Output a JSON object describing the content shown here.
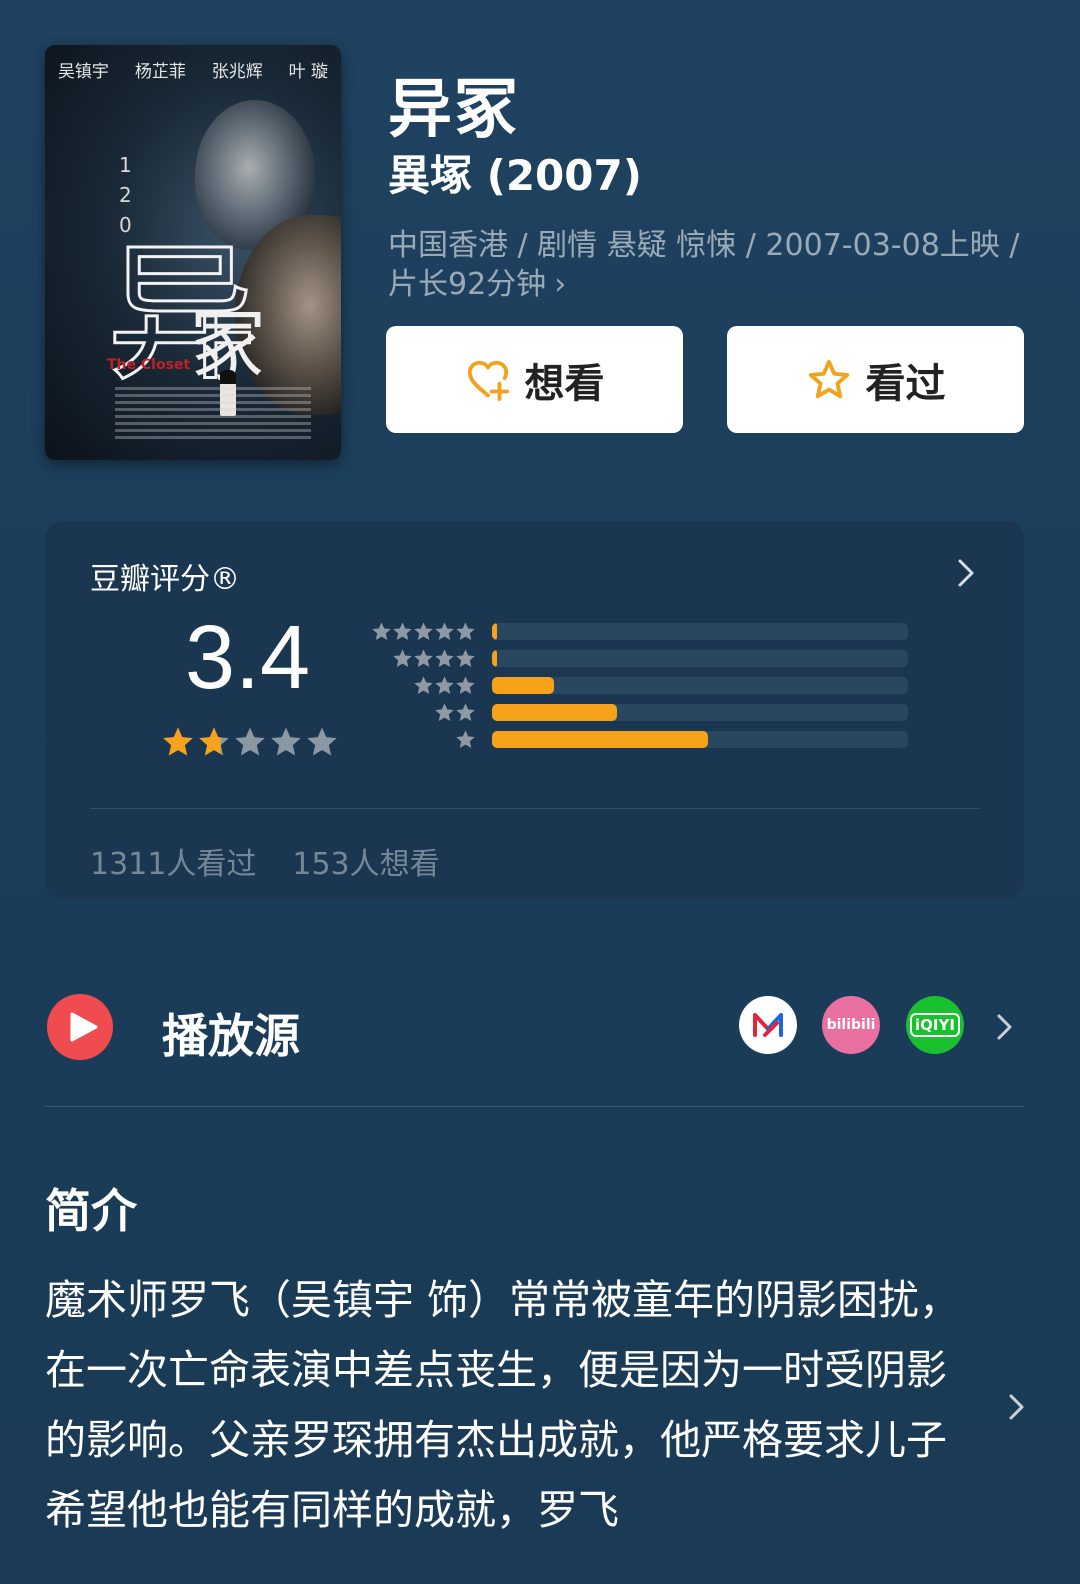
{
  "poster": {
    "actors": [
      "吴镇宇",
      "杨芷菲",
      "张兆辉",
      "叶 璇"
    ],
    "title_big": "异",
    "title_small": "冢",
    "title_en": "The Closet",
    "nums": [
      "1",
      "2",
      "0"
    ]
  },
  "movie": {
    "title": "异冢",
    "original_title": "異塚 (2007)",
    "meta": "中国香港 / 剧情 悬疑 惊悚 / 2007-03-08上映 / 片长92分钟",
    "meta_chevron": "›"
  },
  "actions": {
    "want_label": "想看",
    "seen_label": "看过"
  },
  "rating": {
    "label": "豆瓣评分®",
    "score": "3.4",
    "star_fraction": 0.34,
    "distribution": [
      {
        "stars": 5,
        "fraction": 0.012
      },
      {
        "stars": 4,
        "fraction": 0.012
      },
      {
        "stars": 3,
        "fraction": 0.15
      },
      {
        "stars": 2,
        "fraction": 0.3
      },
      {
        "stars": 1,
        "fraction": 0.52
      }
    ],
    "watched": "1311人看过",
    "wanted": "153人想看"
  },
  "play_source": {
    "label": "播放源",
    "providers": [
      {
        "name": "mgtv-icon"
      },
      {
        "name": "bilibili-icon",
        "text": "bilibili"
      },
      {
        "name": "iqiyi-icon",
        "text": "iQIYI"
      }
    ]
  },
  "intro": {
    "heading": "简介",
    "text": "魔术师罗飞（吴镇宇 饰）常常被童年的阴影困扰，在一次亡命表演中差点丧生，便是因为一时受阴影的影响。父亲罗琛拥有杰出成就，他严格要求儿子希望他也能有同样的成就，罗飞"
  },
  "colors": {
    "background": "#1d3e58",
    "card": "#1a3650",
    "accent": "#f7a21b",
    "play": "#f04b4f"
  }
}
